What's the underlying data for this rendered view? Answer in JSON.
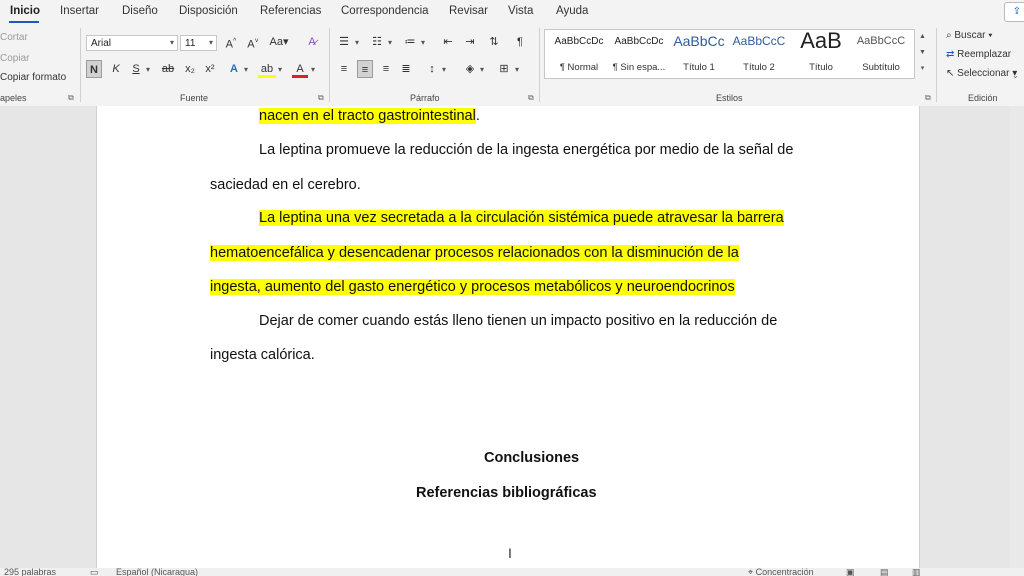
{
  "tabs": [
    "Inicio",
    "Insertar",
    "Diseño",
    "Disposición",
    "Referencias",
    "Correspondencia",
    "Revisar",
    "Vista",
    "Ayuda"
  ],
  "active_tab": "Inicio",
  "share_icon": "share-icon",
  "clipboard": {
    "cut": "Cortar",
    "copy": "Copiar",
    "format_painter": "Copiar formato",
    "label": "apeles"
  },
  "font": {
    "name": "Arial",
    "size": "11",
    "label": "Fuente",
    "grow": "A^",
    "shrink": "A˅",
    "case": "Aa",
    "clear": "A",
    "bold": "N",
    "italic": "K",
    "underline": "S",
    "strike": "ab",
    "subscript": "x₂",
    "superscript": "x²",
    "effects": "A",
    "highlight": "ab",
    "color": "A"
  },
  "paragraph": {
    "label": "Párrafo",
    "pilcrow": "¶"
  },
  "styles": {
    "label": "Estilos",
    "items": [
      {
        "preview": "AaBbCcDc",
        "name": "¶ Normal"
      },
      {
        "preview": "AaBbCcDc",
        "name": "¶ Sin espa..."
      },
      {
        "preview": "AaBbCc",
        "name": "Título 1"
      },
      {
        "preview": "AaBbCcC",
        "name": "Título 2"
      },
      {
        "preview": "AaB",
        "name": "Título"
      },
      {
        "preview": "AaBbCcC",
        "name": "Subtítulo"
      }
    ]
  },
  "editing": {
    "label": "Edición",
    "find": "Buscar",
    "replace": "Reemplazar",
    "select": "Seleccionar"
  },
  "document": {
    "lines": [
      {
        "text": "nacen en el tracto gastrointestinal",
        "tail": "."
      },
      {
        "text": "La leptina promueve la reducción de la ingesta energética por medio de la señal de"
      },
      {
        "text": "saciedad en el cerebro."
      },
      {
        "text": "La leptina una vez secretada a la circulación sistémica puede atravesar la barrera"
      },
      {
        "text": "hematoencefálica y desencadenar procesos relacionados con la disminución de la"
      },
      {
        "text": "ingesta, aumento del gasto energético y procesos metabólicos y neuroendocrinos"
      },
      {
        "text": "Dejar de comer cuando estás lleno tienen un impacto positivo en la reducción de"
      },
      {
        "text": "ingesta calórica."
      }
    ],
    "heading_conclusions": "Conclusiones",
    "heading_references": "Referencias bibliográficas"
  },
  "status": {
    "words": "295 palabras",
    "language": "Español (Nicaragua)",
    "focus": "Concentración"
  },
  "colors": {
    "accent": "#185abd",
    "highlight": "#ffff00"
  }
}
